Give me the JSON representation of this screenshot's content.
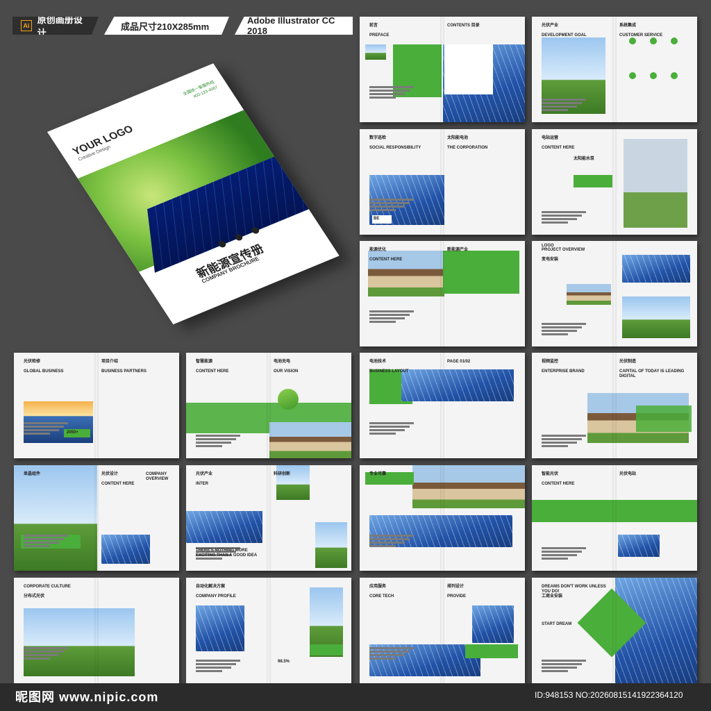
{
  "header": {
    "tag1": "原创画册设计",
    "tag1_icon": "Ai",
    "tag2": "成品尺寸210X285mm",
    "tag3": "Adobe Illustrator CC 2018"
  },
  "cover": {
    "logo": "YOUR LOGO",
    "logo_sub": "Creative Design",
    "contact_line1": "全国统一客服热线",
    "contact_line2": "400-123-4567",
    "title_zh": "新能源宣传册",
    "title_en": "COMPANY BROCHURE"
  },
  "spreads": [
    {
      "id": "preface",
      "left_title": "前言",
      "left_sub": "PREFACE",
      "right_title": "CONTENTS 目录"
    },
    {
      "id": "overview",
      "left_title": "光伏产业",
      "left_sub": "DEVELOPMENT GOAL",
      "right_title": "系统集成",
      "right_sub": "CUSTOMER SERVICE"
    },
    {
      "id": "corporation",
      "left_title": "数字巡检",
      "left_sub": "SOCIAL RESPONSIBILITY",
      "right_title": "太阳能电池",
      "right_sub": "THE CORPORATION",
      "tag": "BE"
    },
    {
      "id": "station",
      "left_title": "电站运营",
      "left_sub": "CONTENT HERE",
      "mid_title": "太阳能水泵"
    },
    {
      "id": "optimize",
      "left_title": "能源优化",
      "left_sub": "CONTENT HERE",
      "right_title": "新能源产业"
    },
    {
      "id": "project",
      "left_title": "PROJECT OVERVIEW",
      "left_sub": "变电安装",
      "logo": "LOGO"
    },
    {
      "id": "pv-check",
      "left_title": "光伏检修",
      "left_sub": "GLOBAL BUSINESS",
      "right_title": "项目介绍",
      "right_sub": "BUSINESS PARTNERS",
      "badge": "2050+"
    },
    {
      "id": "smart",
      "left_title": "智慧能源",
      "left_sub": "CONTENT HERE",
      "right_title": "电池充电",
      "right_sub": "OUR VISION"
    },
    {
      "id": "tech",
      "left_title": "电池技术",
      "left_sub": "BUSINESS LAYOUT",
      "right_title": "PAGE 01/02"
    },
    {
      "id": "monitor",
      "left_title": "视频监控",
      "left_sub": "ENTERPRISE BRAND",
      "right_title": "光伏制造",
      "right_sub": "CAPITAL OF TODAY IS LEADING DIGITAL"
    },
    {
      "id": "module",
      "left_title": "单晶组件",
      "right_title": "光伏设计",
      "right_sub": "CONTENT HERE",
      "right_title2": "COMPANY OVERVIEW"
    },
    {
      "id": "industry",
      "left_title": "光伏产业",
      "left_sub": "INTER",
      "right_title": "科研创新",
      "caption": "THERE'S NOTHING MORE EXCITING THAN A GOOD IDEA"
    },
    {
      "id": "pro",
      "left_title": "专业可靠"
    },
    {
      "id": "smartpv",
      "left_title": "智能光伏",
      "left_sub": "CONTENT HERE",
      "right_title": "光伏电站"
    },
    {
      "id": "corp-culture",
      "left_title": "CORPORATE CULTURE",
      "left_sub": "分布式光伏"
    },
    {
      "id": "solution",
      "left_title": "自动化解决方案",
      "left_sub": "COMPANY PROFILE",
      "stat": "98.5%"
    },
    {
      "id": "service",
      "left_title": "应用服务",
      "left_sub": "CORE TECH",
      "right_title": "排列设计",
      "right_sub": "PROVIDE"
    },
    {
      "id": "dreams",
      "left_title": "DREAMS DON'T WORK UNLESS YOU DO!",
      "left_sub": "工商业安装",
      "left_sub2": "START DREAM"
    }
  ],
  "watermark": {
    "site": "昵图网 www.nipic.com",
    "id_text": "ID:948153 NO:20260815141922364120"
  },
  "colors": {
    "accent": "#4aae3a",
    "background": "#4a4a4a",
    "panel_blue": "#2253a8"
  }
}
